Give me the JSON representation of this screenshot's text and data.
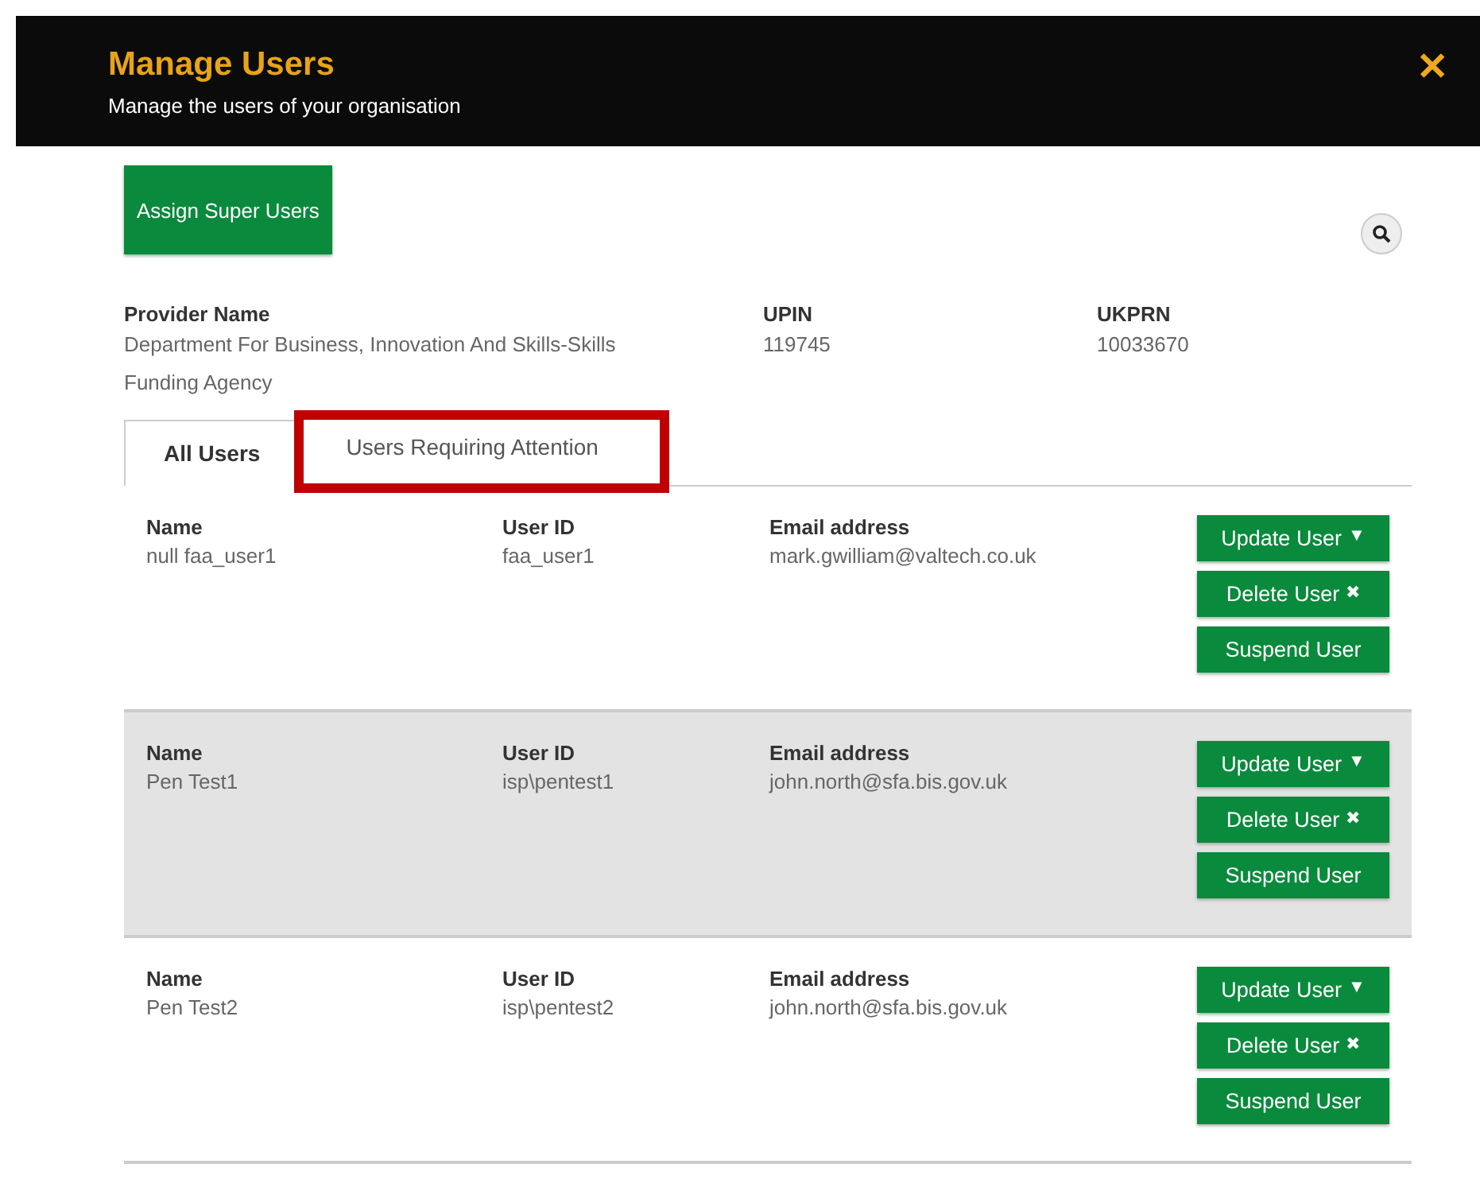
{
  "header": {
    "title": "Manage Users",
    "subtitle": "Manage the users of your organisation",
    "close": "✕"
  },
  "assign_button": "Assign Super Users",
  "provider": {
    "fields": [
      {
        "label": "Provider Name",
        "value": "Department For Business, Innovation And Skills-Skills Funding Agency"
      },
      {
        "label": "UPIN",
        "value": "119745"
      },
      {
        "label": "UKPRN",
        "value": "10033670"
      }
    ]
  },
  "tabs": [
    {
      "label": "All Users",
      "selected": true,
      "highlighted": false
    },
    {
      "label": "Users Requiring Attention",
      "selected": false,
      "highlighted": true
    }
  ],
  "users": [
    {
      "name_label": "Name",
      "name": "null faa_user1",
      "id_label": "User ID",
      "user_id": "faa_user1",
      "email_label": "Email address",
      "email": "mark.gwilliam@valtech.co.uk",
      "highlighted": false,
      "actions": [
        {
          "label": "Update User",
          "icon": "▼"
        },
        {
          "label": "Delete User",
          "icon": "✖"
        },
        {
          "label": "Suspend User"
        }
      ]
    },
    {
      "name_label": "Name",
      "name": "Pen Test1",
      "id_label": "User ID",
      "user_id": "isp\\pentest1",
      "email_label": "Email address",
      "email": "john.north@sfa.bis.gov.uk",
      "highlighted": true,
      "actions": [
        {
          "label": "Update User",
          "icon": "▼"
        },
        {
          "label": "Delete User",
          "icon": "✖"
        },
        {
          "label": "Suspend User"
        }
      ]
    },
    {
      "name_label": "Name",
      "name": "Pen Test2",
      "id_label": "User ID",
      "user_id": "isp\\pentest2",
      "email_label": "Email address",
      "email": "john.north@sfa.bis.gov.uk",
      "highlighted": false,
      "actions": [
        {
          "label": "Update User",
          "icon": "▼"
        },
        {
          "label": "Delete User",
          "icon": "✖"
        },
        {
          "label": "Suspend User"
        }
      ]
    }
  ]
}
